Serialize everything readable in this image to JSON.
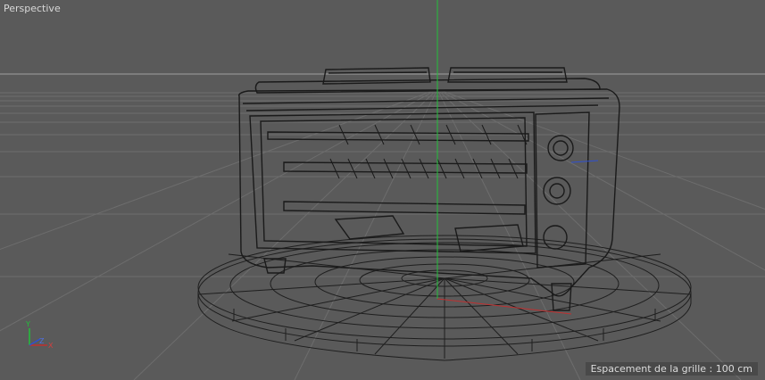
{
  "viewport": {
    "view_name": "Perspective",
    "grid_spacing_text": "Espacement de la grille : 100 cm"
  },
  "axis_gizmo": {
    "y_label": "Y",
    "z_label": "Z",
    "x_label": "X"
  },
  "colors": {
    "background": "#5a5a5a",
    "grid_line": "#6c6c6c",
    "horizon_line": "#9a9a9a",
    "wire": "#1c1c1c",
    "y_axis": "#22c03a",
    "x_axis": "#c03030",
    "z_axis": "#3050d0"
  }
}
